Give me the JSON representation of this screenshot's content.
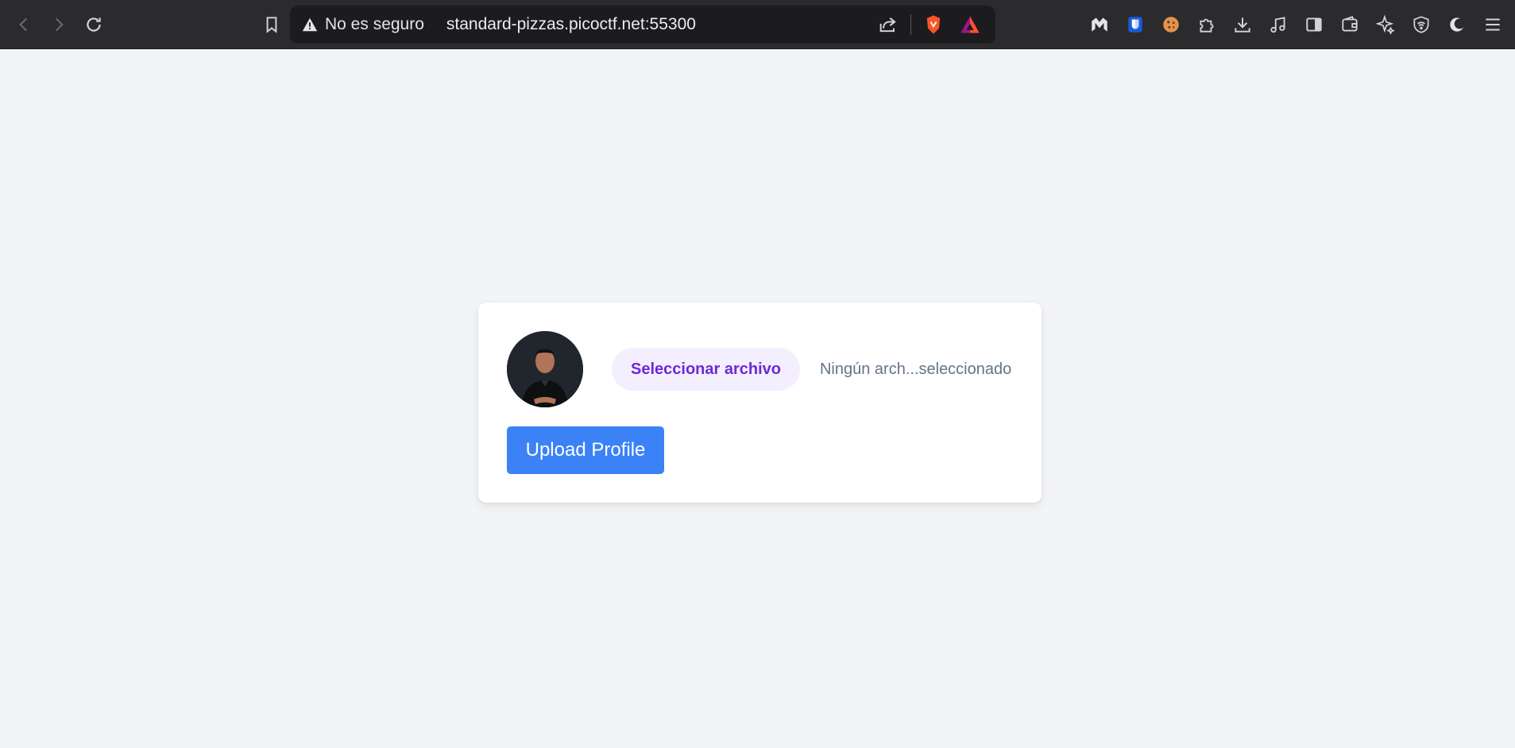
{
  "browser": {
    "security_label": "No es seguro",
    "url": "standard-pizzas.picoctf.net:55300",
    "nav_icons": [
      "back-icon",
      "forward-icon",
      "reload-icon",
      "bookmark-icon"
    ],
    "url_action_icons": [
      "share-icon",
      "brave-shields-icon",
      "brave-rewards-icon"
    ],
    "extension_icons": [
      "malwarebytes-icon",
      "bitwarden-icon",
      "cookie-icon",
      "puzzle-extensions-icon",
      "download-icon",
      "music-icon",
      "sidebar-icon",
      "wallet-icon",
      "leo-ai-icon",
      "vpn-icon",
      "moon-icon",
      "menu-icon"
    ]
  },
  "form": {
    "avatar_icon": "profile-photo",
    "file_button_label": "Seleccionar archivo",
    "file_status": "Ningún arch...seleccionado",
    "upload_label": "Upload Profile"
  },
  "colors": {
    "toolbar_bg": "#2b2b2e",
    "page_bg": "#f3f4f6",
    "upload_button": "#3b82f6",
    "file_button_bg": "#f3effe",
    "file_button_text": "#6d28d9"
  }
}
